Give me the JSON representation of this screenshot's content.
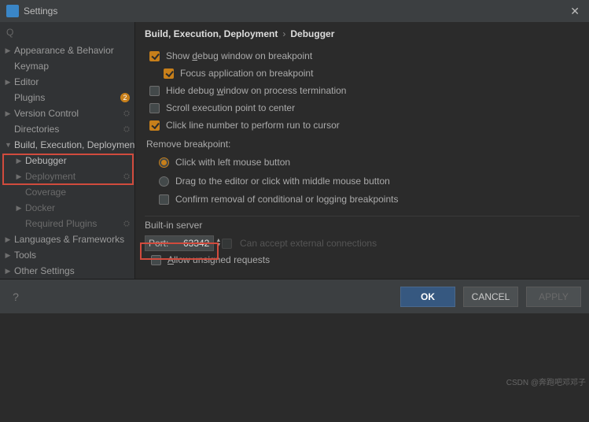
{
  "window": {
    "title": "Settings"
  },
  "search": {
    "placeholder": "Q"
  },
  "sidebar": {
    "items": [
      {
        "label": "Appearance & Behavior"
      },
      {
        "label": "Keymap"
      },
      {
        "label": "Editor"
      },
      {
        "label": "Plugins",
        "badge": "2"
      },
      {
        "label": "Version Control"
      },
      {
        "label": "Directories"
      },
      {
        "label": "Build, Execution, Deployment"
      },
      {
        "label": "Debugger"
      },
      {
        "label": "Deployment"
      },
      {
        "label": "Coverage"
      },
      {
        "label": "Docker"
      },
      {
        "label": "Required Plugins"
      },
      {
        "label": "Languages & Frameworks"
      },
      {
        "label": "Tools"
      },
      {
        "label": "Other Settings"
      }
    ]
  },
  "breadcrumb": {
    "a": "Build, Execution, Deployment",
    "sep": "›",
    "b": "Debugger"
  },
  "options": {
    "show_debug": "Show debug window on breakpoint",
    "focus_app": "Focus application on breakpoint",
    "hide_dbg": "Hide debug window on process termination",
    "scroll_center": "Scroll execution point to center",
    "click_line": "Click line number to perform run to cursor",
    "remove_bp": "Remove breakpoint:",
    "rb_left": "Click with left mouse button",
    "rb_middle": "Drag to the editor or click with middle mouse button",
    "confirm_remove": "Confirm removal of conditional or logging breakpoints"
  },
  "server": {
    "title": "Built-in server",
    "port_label": "Port:",
    "port": "63342",
    "ext_chk_label": "Can accept external connections",
    "allow_unsigned": "Allow unsigned requests"
  },
  "footer": {
    "ok": "OK",
    "cancel": "CANCEL",
    "apply": "APPLY"
  },
  "watermark": "CSDN @奔跑吧邓邓子"
}
